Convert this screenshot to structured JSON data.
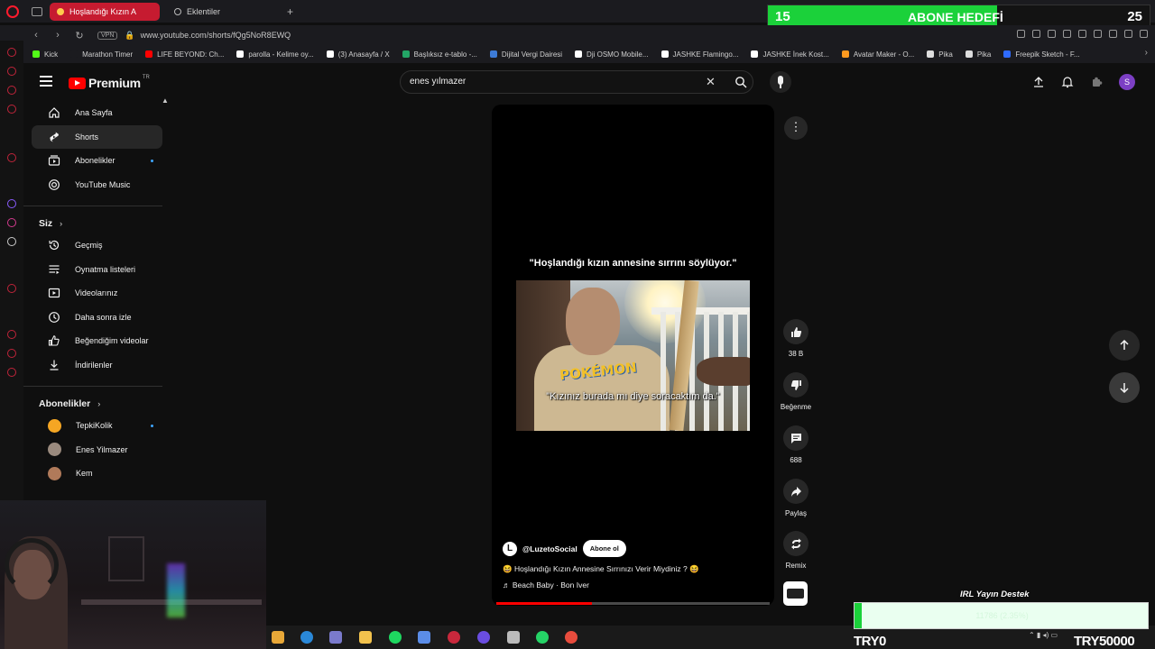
{
  "browser": {
    "active_tab": "Hoşlandığı Kızın A",
    "inactive_tab": "Eklentiler",
    "vpn_label": "VPN",
    "url": "www.youtube.com/shorts/fQg5NoR8EWQ",
    "bookmarks": [
      {
        "label": "Kick",
        "color": "#53fc18"
      },
      {
        "label": "Marathon Timer",
        "color": "#1b1b1f"
      },
      {
        "label": "LIFE BEYOND: Ch...",
        "color": "#ff0000"
      },
      {
        "label": "parolla - Kelime oy...",
        "color": "#ffffff"
      },
      {
        "label": "(3) Anasayfa / X",
        "color": "#ffffff"
      },
      {
        "label": "Başlıksız e-tablo -...",
        "color": "#23a566"
      },
      {
        "label": "Dijital Vergi Dairesi",
        "color": "#3d7bd6"
      },
      {
        "label": "Dji OSMO Mobile...",
        "color": "#ffffff"
      },
      {
        "label": "JASHKE Flamingo...",
        "color": "#ffffff"
      },
      {
        "label": "JASHKE İnek Kost...",
        "color": "#ffffff"
      },
      {
        "label": "Avatar Maker - O...",
        "color": "#ff9a1f"
      },
      {
        "label": "Pika",
        "color": "#dddddd"
      },
      {
        "label": "Pika",
        "color": "#dddddd"
      },
      {
        "label": "Freepik Sketch - F...",
        "color": "#2f6bff"
      }
    ]
  },
  "goal": {
    "current": "15",
    "target": "25",
    "title": "ABONE HEDEFİ",
    "fraction": 0.6,
    "color": "#1bd13a"
  },
  "youtube": {
    "logo_text": "Premium",
    "logo_region": "TR",
    "search_value": "enes yılmazer",
    "avatar_letter": "S",
    "accent": "#ff0000"
  },
  "sidebar": {
    "main": [
      {
        "label": "Ana Sayfa",
        "icon": "home-icon"
      },
      {
        "label": "Shorts",
        "icon": "shorts-icon",
        "active": true
      },
      {
        "label": "Abonelikler",
        "icon": "subscriptions-icon",
        "dot": true
      },
      {
        "label": "YouTube Music",
        "icon": "music-icon"
      }
    ],
    "you_header": "Siz",
    "you": [
      {
        "label": "Geçmiş",
        "icon": "history-icon"
      },
      {
        "label": "Oynatma listeleri",
        "icon": "playlist-icon"
      },
      {
        "label": "Videolarınız",
        "icon": "video-icon"
      },
      {
        "label": "Daha sonra izle",
        "icon": "clock-icon"
      },
      {
        "label": "Beğendiğim videolar",
        "icon": "thumb-up-icon"
      },
      {
        "label": "İndirilenler",
        "icon": "download-icon"
      }
    ],
    "subs_header": "Abonelikler",
    "subs": [
      {
        "label": "TepkiKolik",
        "color": "#f5a623",
        "dot": true
      },
      {
        "label": "Enes Yilmazer",
        "color": "#9a8a7e"
      },
      {
        "label": "Kem",
        "color": "#b07a5a"
      }
    ]
  },
  "short": {
    "overlay_caption": "\"Hoşlandığı kızın annesine sırrını söylüyor.\"",
    "subtitle": "\"Kızınız burada mı diye soracaktım da.\"",
    "shirt_text": "POKÉMON",
    "channel_letter": "L",
    "channel": "@LuzetoSocial",
    "subscribe_label": "Abone ol",
    "title": "😆 Hoşlandığı Kızın Annesine Sırrınızı Verir Miydiniz ? 😆",
    "music": "♬ Beach Baby · Bon Iver",
    "progress": 0.35
  },
  "actions": {
    "like_count": "38 B",
    "dislike_label": "Beğenme",
    "comment_count": "688",
    "share_label": "Paylaş",
    "remix_label": "Remix"
  },
  "stream": {
    "try_left": "TRY0",
    "try_right": "TRY50000",
    "donate_title": "IRL Yayın Destek",
    "donate_amount": "11786 (2.35%)",
    "donate_fraction": 0.0235
  }
}
